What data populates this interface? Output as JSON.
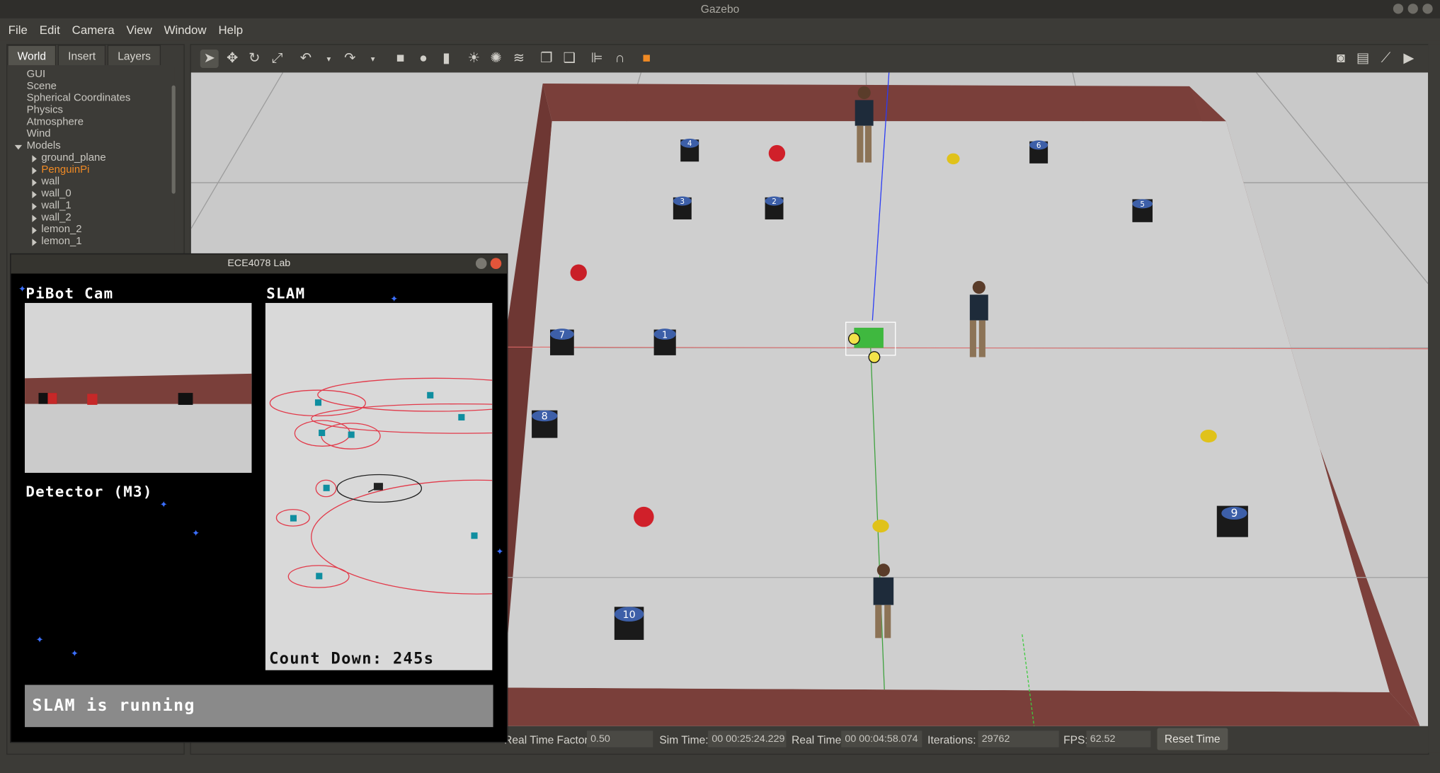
{
  "window": {
    "title": "Gazebo"
  },
  "menu": [
    "File",
    "Edit",
    "Camera",
    "View",
    "Window",
    "Help"
  ],
  "left_panel": {
    "tabs": [
      "World",
      "Insert",
      "Layers"
    ],
    "tree": [
      {
        "label": "GUI",
        "level": 0
      },
      {
        "label": "Scene",
        "level": 0
      },
      {
        "label": "Spherical Coordinates",
        "level": 0
      },
      {
        "label": "Physics",
        "level": 0
      },
      {
        "label": "Atmosphere",
        "level": 0
      },
      {
        "label": "Wind",
        "level": 0
      },
      {
        "label": "Models",
        "level": 0
      },
      {
        "label": "ground_plane",
        "level": 1
      },
      {
        "label": "PenguinPi",
        "level": 1
      },
      {
        "label": "wall",
        "level": 1
      },
      {
        "label": "wall_0",
        "level": 1
      },
      {
        "label": "wall_1",
        "level": 1
      },
      {
        "label": "wall_2",
        "level": 1
      },
      {
        "label": "lemon_2",
        "level": 1
      },
      {
        "label": "lemon_1",
        "level": 1
      }
    ]
  },
  "status": {
    "real_time_factor_label": "Real Time Factor:",
    "real_time_factor": "0.50",
    "sim_time_label": "Sim Time:",
    "sim_time": "00 00:25:24.229",
    "real_time_label": "Real Time:",
    "real_time": "00 00:04:58.074",
    "iterations_label": "Iterations:",
    "iterations": "29762",
    "fps_label": "FPS:",
    "fps": "62.52",
    "reset_label": "Reset Time"
  },
  "lab": {
    "title": "ECE4078 Lab",
    "cam_label": "PiBot Cam",
    "slam_label": "SLAM",
    "detector_label": "Detector (M3)",
    "countdown": "Count Down: 245s",
    "status_text": "SLAM is running"
  },
  "scene": {
    "markers": [
      "1",
      "2",
      "3",
      "4",
      "5",
      "6",
      "7",
      "8",
      "9",
      "10"
    ]
  },
  "colors": {
    "accent": "#f08a24",
    "wall": "#7a3f3a",
    "floor": "#c9c9c9"
  }
}
